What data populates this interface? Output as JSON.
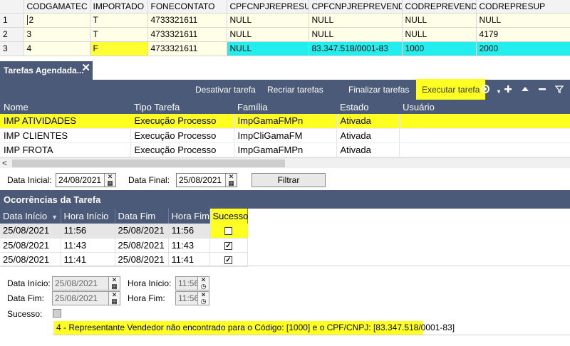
{
  "top_grid": {
    "columns": [
      "",
      "CODGAMATEC",
      "IMPORTADO",
      "FONECONTATO",
      "CPFCNPJREPRESUP",
      "CPFCNPJREPREVEND",
      "CODREPREVEND",
      "CODREPRESUP"
    ],
    "rows": [
      [
        "1",
        "2",
        "T",
        "4733321611",
        "NULL",
        "NULL",
        "NULL",
        "NULL"
      ],
      [
        "2",
        "3",
        "T",
        "4733321611",
        "NULL",
        "NULL",
        "NULL",
        "4179"
      ],
      [
        "3",
        "4",
        "F",
        "4733321611",
        "NULL",
        "83.347.518/0001-83",
        "1000",
        "2000"
      ]
    ]
  },
  "panel": {
    "tab_title": "Tarefas Agendada...",
    "close_glyph": "✕"
  },
  "toolbar": {
    "deactivate": "Desativar tarefa",
    "recreate": "Recriar tarefas",
    "finish": "Finalizar tarefas",
    "execute": "Executar tarefa",
    "icons": [
      "settings-icon",
      "add-icon",
      "move-up-icon",
      "remove-icon",
      "filter-icon"
    ]
  },
  "tasks_grid": {
    "columns": [
      "Nome",
      "Tipo Tarefa",
      "Família",
      "Estado",
      "Usuário"
    ],
    "rows": [
      [
        "IMP ATIVIDADES",
        "Execução Processo",
        "ImpGamaFMPn",
        "Ativada",
        ""
      ],
      [
        "IMP CLIENTES",
        "Execução Processo",
        "ImpCliGamaFM",
        "Ativada",
        ""
      ],
      [
        "IMP FROTA",
        "Execução Processo",
        "ImpGamaFMPn",
        "Ativada",
        ""
      ]
    ]
  },
  "filter": {
    "start_label": "Data Inicial:",
    "start_value": "24/08/2021",
    "end_label": "Data Final:",
    "end_value": "25/08/2021",
    "button": "Filtrar"
  },
  "occurrences": {
    "title": "Ocorrências da Tarefa",
    "columns": [
      "Data Início",
      "Hora Início",
      "Data Fim",
      "Hora Fim",
      "Sucesso"
    ],
    "rows": [
      {
        "data_inicio": "25/08/2021",
        "hora_inicio": "11:56",
        "data_fim": "25/08/2021",
        "hora_fim": "11:56",
        "sucesso": false
      },
      {
        "data_inicio": "25/08/2021",
        "hora_inicio": "11:43",
        "data_fim": "25/08/2021",
        "hora_fim": "11:43",
        "sucesso": true
      },
      {
        "data_inicio": "25/08/2021",
        "hora_inicio": "11:41",
        "data_fim": "25/08/2021",
        "hora_fim": "11:41",
        "sucesso": true
      }
    ]
  },
  "detail": {
    "data_inicio_label": "Data Início:",
    "data_inicio_value": "25/08/2021",
    "hora_inicio_label": "Hora Início:",
    "hora_inicio_value": "11:56",
    "data_fim_label": "Data Fim:",
    "data_fim_value": "25/08/2021",
    "hora_fim_label": "Hora Fim:",
    "hora_fim_value": "11:56",
    "sucesso_label": "Sucesso:",
    "message": "4 - Representante Vendedor não encontrado para o Código: [1000] e o CPF/CNPJ: [83.347.518/0001-83]"
  },
  "colors": {
    "panel_header": "#4a5a78",
    "highlight_yellow": "#ffff22",
    "highlight_cyan": "#22eeee",
    "grid_row_bg": "#ffffe8"
  }
}
